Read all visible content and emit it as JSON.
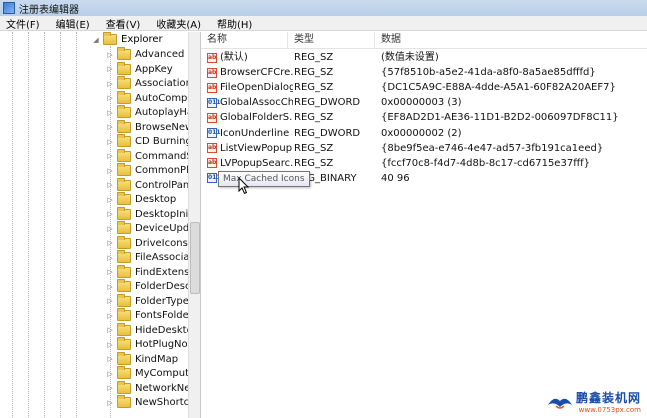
{
  "window": {
    "title": "注册表编辑器"
  },
  "menu": [
    "文件(F)",
    "编辑(E)",
    "查看(V)",
    "收藏夹(A)",
    "帮助(H)"
  ],
  "tree": {
    "parent": {
      "label": "Explorer",
      "expander": "◢"
    },
    "children": [
      "Advanced",
      "AppKey",
      "Associations",
      "AutoComplet",
      "AutoplayHan",
      "BrowseNewP",
      "CD Burning",
      "CommandSto",
      "CommonPlac",
      "ControlPanel",
      "Desktop",
      "DesktopIniPr",
      "DeviceUpdat",
      "DriveIcons",
      "FileAssociatio",
      "FindExtension",
      "FolderDescri",
      "FolderTypes",
      "FontsFolder",
      "HideDesktop",
      "HotPlugNotif",
      "KindMap",
      "MyComputer",
      "NetworkNeig",
      "NewShortcut"
    ],
    "child_expander": "▷"
  },
  "list": {
    "columns": {
      "name": "名称",
      "type": "类型",
      "data": "数据"
    },
    "rows": [
      {
        "icon": "string-value-icon",
        "name": "(默认)",
        "type": "REG_SZ",
        "data": "(数值未设置)"
      },
      {
        "icon": "string-value-icon",
        "name": "BrowserCFCre...",
        "type": "REG_SZ",
        "data": "{57f8510b-a5e2-41da-a8f0-8a5ae85dfffd}"
      },
      {
        "icon": "string-value-icon",
        "name": "FileOpenDialog",
        "type": "REG_SZ",
        "data": "{DC1C5A9C-E88A-4dde-A5A1-60F82A20AEF7}"
      },
      {
        "icon": "binary-value-icon",
        "name": "GlobalAssocCh...",
        "type": "REG_DWORD",
        "data": "0x00000003 (3)"
      },
      {
        "icon": "string-value-icon",
        "name": "GlobalFolderS...",
        "type": "REG_SZ",
        "data": "{EF8AD2D1-AE36-11D1-B2D2-006097DF8C11}"
      },
      {
        "icon": "binary-value-icon",
        "name": "IconUnderline",
        "type": "REG_DWORD",
        "data": "0x00000002 (2)"
      },
      {
        "icon": "string-value-icon",
        "name": "ListViewPopup...",
        "type": "REG_SZ",
        "data": "{8be9f5ea-e746-4e47-ad57-3fb191ca1eed}"
      },
      {
        "icon": "string-value-icon",
        "name": "LVPopupSearc...",
        "type": "REG_SZ",
        "data": "{fccf70c8-f4d7-4d8b-8c17-cd6715e37fff}"
      },
      {
        "icon": "binary-value-icon",
        "name": "",
        "type": "REG_BINARY",
        "data": "40 96"
      }
    ]
  },
  "tooltip": {
    "text": "Max Cached Icons"
  },
  "watermark": {
    "title": "鹏鑫装机网",
    "url": "www.0753px.com"
  }
}
